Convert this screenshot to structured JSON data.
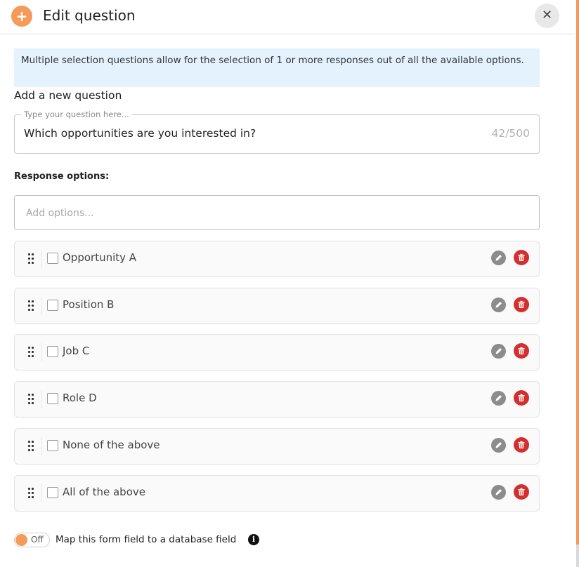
{
  "header": {
    "title": "Edit question",
    "logo_glyph": "+",
    "close_glyph": "✕"
  },
  "info_text": "Multiple selection questions allow for the selection of 1 or more responses out of all the available options.",
  "add_question_label": "Add a new question",
  "question_field": {
    "legend": "Type your question here...",
    "value": "Which opportunities are you interested in?",
    "counter": "42/500"
  },
  "response_options_label": "Response options:",
  "options_input": {
    "placeholder": "Add options..."
  },
  "options": [
    {
      "label": "Opportunity A"
    },
    {
      "label": "Position B"
    },
    {
      "label": "Job C"
    },
    {
      "label": "Role D"
    },
    {
      "label": "None of the above"
    },
    {
      "label": "All of the above"
    }
  ],
  "mapping": {
    "toggle_state": "Off",
    "label": "Map this form field to a database field",
    "info_glyph": "i"
  },
  "colors": {
    "accent": "#f59a58",
    "danger": "#d32f2f",
    "info_bg": "#e3f2fd",
    "edit_icon_bg": "#8c8c8c"
  }
}
